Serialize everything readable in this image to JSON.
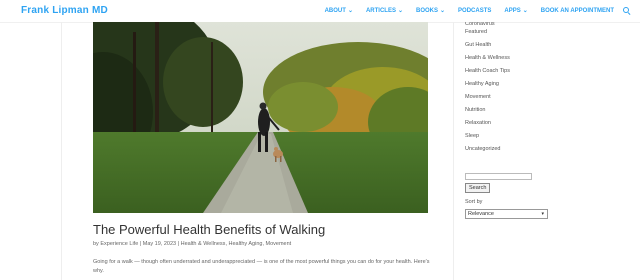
{
  "header": {
    "logo": "Frank Lipman MD",
    "nav": [
      {
        "label": "ABOUT",
        "has_dropdown": true
      },
      {
        "label": "ARTICLES",
        "has_dropdown": true
      },
      {
        "label": "BOOKS",
        "has_dropdown": true
      },
      {
        "label": "PODCASTS",
        "has_dropdown": false
      },
      {
        "label": "APPS",
        "has_dropdown": true
      },
      {
        "label": "BOOK AN APPOINTMENT",
        "has_dropdown": false
      }
    ],
    "caret": "⌄",
    "search_icon": "search-icon"
  },
  "post": {
    "title": "The Powerful Health Benefits of Walking",
    "meta_prefix": "by ",
    "author": "Experience Life",
    "separator": " | ",
    "date": "May 19, 2023",
    "categories": [
      "Health & Wellness",
      "Healthy Aging",
      "Movement"
    ],
    "excerpt": "Going for a walk — though often underrated and underappreciated — is one of the most powerful things you can do for your health. Here's why."
  },
  "sidebar": {
    "categories": [
      "Coronavirus",
      "Featured",
      "Gut Health",
      "Health & Wellness",
      "Health Coach Tips",
      "Healthy Aging",
      "Movement",
      "Nutrition",
      "Relaxation",
      "Sleep",
      "Uncategorized"
    ],
    "search_value": "",
    "search_button": "Search",
    "sort_label": "Sort by",
    "sort_selected": "Relevance"
  },
  "colors": {
    "accent": "#2ea3f2",
    "text": "#333333",
    "muted": "#666666"
  }
}
